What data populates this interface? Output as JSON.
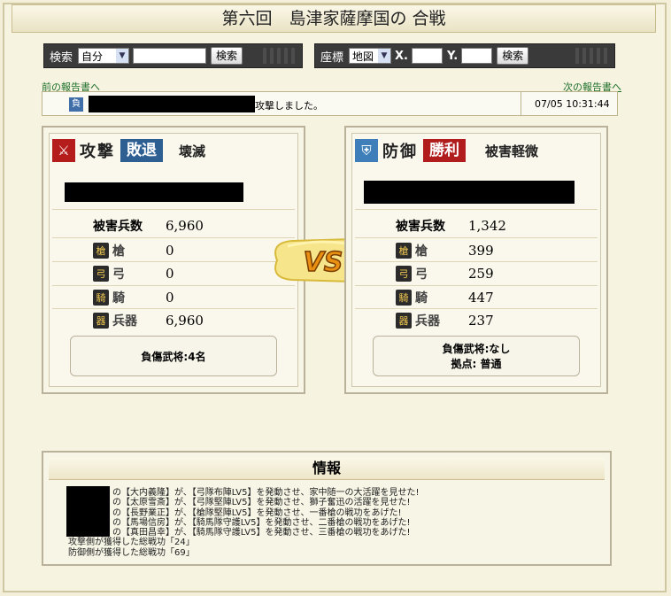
{
  "title": "第六回　島津家薩摩国の 合戦",
  "search_bar": {
    "label": "検索",
    "select_value": "自分",
    "input_value": "",
    "button": "検索"
  },
  "coord_bar": {
    "label": "座標",
    "select_value": "地図",
    "x_label": "X.",
    "x_value": "",
    "y_label": "Y.",
    "y_value": "",
    "button": "検索"
  },
  "nav": {
    "prev": "前の報告書へ",
    "next": "次の報告書へ"
  },
  "message": {
    "badge": "負",
    "text": "攻撃しました。",
    "time": "07/05 10:31:44"
  },
  "attack": {
    "role": "攻撃",
    "result": "敗退",
    "damage": "壊滅",
    "casualties_label": "被害兵数",
    "casualties": "6,960",
    "units": [
      {
        "icon": "spear-icon",
        "label": "槍",
        "value": "0"
      },
      {
        "icon": "bow-icon",
        "label": "弓",
        "value": "0"
      },
      {
        "icon": "horse-icon",
        "label": "騎",
        "value": "0"
      },
      {
        "icon": "weapon-icon",
        "label": "兵器",
        "value": "6,960"
      }
    ],
    "box_line1": "負傷武将:4名"
  },
  "defense": {
    "role": "防御",
    "result": "勝利",
    "damage": "被害軽微",
    "casualties_label": "被害兵数",
    "casualties": "1,342",
    "units": [
      {
        "icon": "spear-icon",
        "label": "槍",
        "value": "399"
      },
      {
        "icon": "bow-icon",
        "label": "弓",
        "value": "259"
      },
      {
        "icon": "horse-icon",
        "label": "騎",
        "value": "447"
      },
      {
        "icon": "weapon-icon",
        "label": "兵器",
        "value": "237"
      }
    ],
    "box_line1": "負傷武将:なし",
    "box_line2": "拠点: 普通"
  },
  "vs_label": "VS",
  "info": {
    "title": "情報",
    "lines": [
      "の【大内義隆】が、【弓隊布陣LV5】を発動させ、家中随一の大活躍を見せた!",
      "の【太原雪斎】が、【弓隊堅陣LV5】を発動させ、獅子奮迅の活躍を見せた!",
      "の【長野業正】が、【槍隊堅陣LV5】を発動させ、一番槍の戦功をあげた!",
      "の【馬場信房】が、【騎馬隊守護LV5】を発動させ、二番槍の戦功をあげた!",
      "の【真田昌幸】が、【騎馬隊守護LV5】を発動させ、三番槍の戦功をあげた!",
      "攻撃側が獲得した総戦功「24」",
      "防御側が獲得した総戦功「69」"
    ]
  }
}
